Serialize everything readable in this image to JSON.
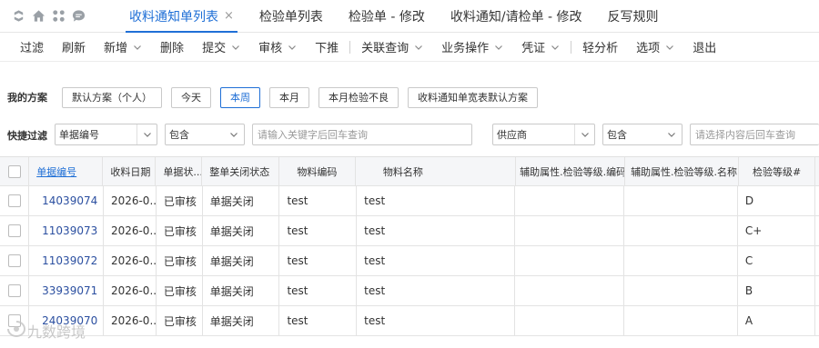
{
  "tabs": [
    {
      "label": "收料通知单列表",
      "active": true,
      "closable": true
    },
    {
      "label": "检验单列表",
      "active": false
    },
    {
      "label": "检验单 - 修改",
      "active": false
    },
    {
      "label": "收料通知/请检单 - 修改",
      "active": false
    },
    {
      "label": "反写规则",
      "active": false
    }
  ],
  "tab_close_glyph": "×",
  "toolbar": {
    "filter": "过滤",
    "refresh": "刷新",
    "new": "新增",
    "delete": "删除",
    "submit": "提交",
    "audit": "审核",
    "push_down": "下推",
    "related_query": "关联查询",
    "business_ops": "业务操作",
    "voucher": "凭证",
    "light_analysis": "轻分析",
    "options": "选项",
    "exit": "退出"
  },
  "scheme": {
    "label": "我的方案",
    "buttons": [
      "默认方案（个人）",
      "今天",
      "本周",
      "本月",
      "本月检验不良",
      "收料通知单宽表默认方案"
    ],
    "active_index": 2
  },
  "quick_filter": {
    "label": "快捷过滤",
    "field1": "单据编号",
    "op1": "包含",
    "value1_placeholder": "请输入关键字后回车查询",
    "field2": "供应商",
    "op2": "包含",
    "value2_placeholder": "请选择内容后回车查询"
  },
  "table": {
    "columns": [
      "单据编号",
      "收料日期",
      "单据状...",
      "整单关闭状态",
      "物料编码",
      "物料名称",
      "辅助属性.检验等级.编码",
      "辅助属性.检验等级.名称",
      "检验等级#"
    ],
    "rows": [
      {
        "billno": "14039074",
        "date": "2026-0...",
        "status": "已审核",
        "close": "单据关闭",
        "code": "test",
        "name": "test",
        "aux_code": "",
        "aux_name": "",
        "grade": "D"
      },
      {
        "billno": "11039073",
        "date": "2026-0...",
        "status": "已审核",
        "close": "单据关闭",
        "code": "test",
        "name": "test",
        "aux_code": "",
        "aux_name": "",
        "grade": "C+"
      },
      {
        "billno": "11039072",
        "date": "2026-0...",
        "status": "已审核",
        "close": "单据关闭",
        "code": "test",
        "name": "test",
        "aux_code": "",
        "aux_name": "",
        "grade": "C"
      },
      {
        "billno": "33939071",
        "date": "2026-0...",
        "status": "已审核",
        "close": "单据关闭",
        "code": "test",
        "name": "test",
        "aux_code": "",
        "aux_name": "",
        "grade": "B"
      },
      {
        "billno": "24039070",
        "date": "2026-0...",
        "status": "已审核",
        "close": "单据关闭",
        "code": "test",
        "name": "test",
        "aux_code": "",
        "aux_name": "",
        "grade": "A"
      }
    ]
  },
  "watermark": "九数跨境",
  "colors": {
    "accent": "#1f6fd6",
    "border": "#c9c9c9",
    "header_bg": "#f5f6f8"
  }
}
